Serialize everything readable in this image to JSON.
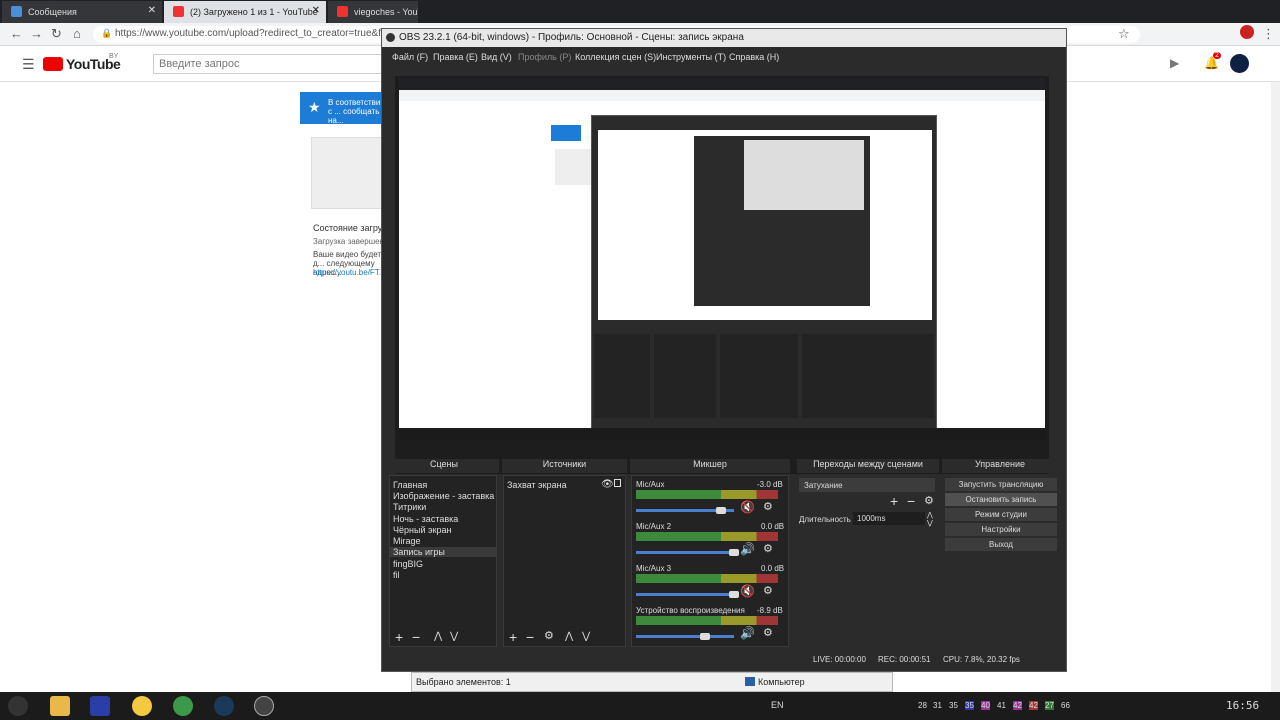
{
  "browser": {
    "tabs": [
      {
        "label": "Сообщения",
        "color": "#4a90d9"
      },
      {
        "label": "(2) Загружено 1 из 1 - YouTube",
        "color": "#e33"
      },
      {
        "label": "viegoches - YouTube",
        "color": "#e33"
      }
    ],
    "url": "https://www.youtube.com/upload?redirect_to_creator=true&fr=4"
  },
  "youtube": {
    "logo": "YouTube",
    "region": "BY",
    "search_placeholder": "Введите запрос",
    "notif_count": "2",
    "banner": "В соответствии с ... сообщать на...",
    "status_title": "Состояние загру...",
    "status_sub": "Загрузка завершен...",
    "status_text": "Ваше видео будет д... следующему адрес...",
    "link": "https://youtu.be/FT..."
  },
  "obs": {
    "title": "OBS 23.2.1 (64-bit, windows) - Профиль: Основной - Сцены: запись экрана",
    "menu": [
      "Файл (F)",
      "Правка (E)",
      "Вид (V)",
      "Профиль (P)",
      "Коллекция сцен (S)",
      "Инструменты (T)",
      "Справка (H)"
    ],
    "docks": {
      "scenes": "Сцены",
      "sources": "Источники",
      "mixer": "Микшер",
      "transitions": "Переходы между сценами",
      "controls": "Управление"
    },
    "scenes": [
      "Главная",
      "Изображение - заставка",
      "Титрики",
      "Ночь - заставка",
      "Чёрный экран",
      "Mirage",
      "Запись игры",
      "fingBIG",
      "fil"
    ],
    "selected_scene": "Запись игры",
    "sources": [
      "Захват экрана"
    ],
    "mixer": [
      {
        "name": "Mic/Aux",
        "db": "-3.0 dB",
        "muted": true
      },
      {
        "name": "Mic/Aux 2",
        "db": "0.0 dB",
        "muted": false
      },
      {
        "name": "Mic/Aux 3",
        "db": "0.0 dB",
        "muted": true
      },
      {
        "name": "Устройство воспроизведения",
        "db": "-8.9 dB",
        "muted": false
      }
    ],
    "meter_scale": "-60 -55 -50 -45 -40 -35 -30 -25 -20 -15 -10 -5 0",
    "transition": "Затухание",
    "duration_label": "Длительность",
    "duration": "1000ms",
    "controls": [
      "Запустить трансляцию",
      "Остановить запись",
      "Режим студии",
      "Настройки",
      "Выход"
    ],
    "status": {
      "live": "LIVE: 00:00:00",
      "rec": "REC: 00:00:51",
      "cpu": "CPU: 7.8%, 20.32 fps"
    }
  },
  "explorer_status": {
    "selected": "Выбрано элементов: 1",
    "computer": "Компьютер"
  },
  "taskbar": {
    "lang": "EN",
    "time": "16:56",
    "nums": [
      "28",
      "31",
      "35",
      "35",
      "40",
      "41",
      "42",
      "42",
      "27",
      "66"
    ]
  }
}
